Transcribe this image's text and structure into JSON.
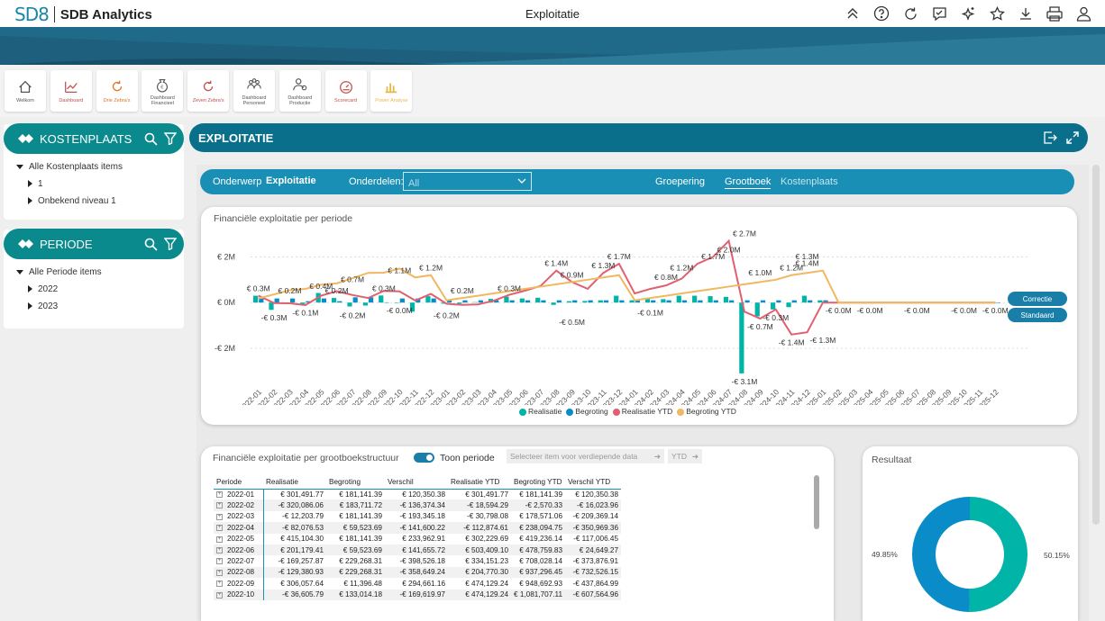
{
  "app": {
    "logo_mark": "SD8",
    "brand": "SDB Analytics",
    "title": "Exploitatie"
  },
  "topicons": [
    "collapse-icon",
    "help-icon",
    "refresh-icon",
    "comment-icon",
    "sparkle-icon",
    "favorite-icon",
    "download-icon",
    "print-icon",
    "user-icon"
  ],
  "nav": [
    {
      "label": "Welkom",
      "icon": "home-icon",
      "color": "#555555"
    },
    {
      "label": "Dashboard",
      "icon": "line-chart-icon",
      "color": "#c0504d"
    },
    {
      "label": "Drie Zebra's",
      "icon": "refresh-cycle-icon",
      "color": "#e07020"
    },
    {
      "label": "Dashboard Financieel",
      "icon": "money-bag-icon",
      "color": "#555555"
    },
    {
      "label": "Zeven Zebra's",
      "icon": "refresh-cycle-icon",
      "color": "#c0504d"
    },
    {
      "label": "Dashboard Personeel",
      "icon": "people-icon",
      "color": "#555555"
    },
    {
      "label": "Dashboard Productie",
      "icon": "worker-icon",
      "color": "#555555"
    },
    {
      "label": "Scorecard",
      "icon": "gauge-icon",
      "color": "#c0504d"
    },
    {
      "label": "Power Analyse",
      "icon": "bar-chart-icon",
      "color": "#e8b84a"
    }
  ],
  "kostenplaats": {
    "title": "KOSTENPLAATS",
    "items": [
      "Alle Kostenplaats items",
      "1",
      "Onbekend niveau 1"
    ]
  },
  "periode": {
    "title": "PERIODE",
    "items": [
      "Alle Periode items",
      "2022",
      "2023"
    ]
  },
  "exploitatie": {
    "title": "EXPLOITATIE"
  },
  "selbar": {
    "onderwerp_label": "Onderwerp",
    "onderwerp_value": "Exploitatie",
    "onderdelen_label": "Onderdelen:",
    "onderdelen_value": "All",
    "groepering": "Groepering",
    "grootboek": "Grootboek",
    "kostenplaats": "Kostenplaats"
  },
  "chart_title": "Financiële exploitatie per periode",
  "chart_buttons": {
    "correctie": "Correctie",
    "standaard": "Standaard"
  },
  "chart_data": {
    "type": "bar",
    "y_ticks": [
      "€ 2M",
      "€ 0M",
      "-€ 2M"
    ],
    "ylim": [
      -3.5,
      3.2
    ],
    "categories": [
      "2022-01",
      "2022-02",
      "2022-03",
      "2022-04",
      "2022-05",
      "2022-06",
      "2022-07",
      "2022-08",
      "2022-09",
      "2022-10",
      "2022-11",
      "2022-12",
      "2023-01",
      "2023-02",
      "2023-03",
      "2023-04",
      "2023-05",
      "2023-06",
      "2023-07",
      "2023-08",
      "2023-09",
      "2023-10",
      "2023-11",
      "2023-12",
      "2024-01",
      "2024-02",
      "2024-03",
      "2024-04",
      "2024-05",
      "2024-06",
      "2024-07",
      "2024-08",
      "2024-09",
      "2024-10",
      "2024-11",
      "2024-12",
      "2025-01",
      "2025-02",
      "2025-03",
      "2025-04",
      "2025-05",
      "2025-06",
      "2025-07",
      "2025-08",
      "2025-09",
      "2025-10",
      "2025-11",
      "2025-12"
    ],
    "series": [
      {
        "name": "Realisatie",
        "color": "#00b4a8",
        "values": [
          0.3,
          -0.32,
          -0.01,
          -0.08,
          0.42,
          0.2,
          -0.17,
          -0.13,
          0.31,
          -0.02,
          -0.4,
          0.28,
          -0.05,
          -0.05,
          0.02,
          0.16,
          0.26,
          0.18,
          0.21,
          -0.1,
          0.06,
          0.07,
          0.1,
          0.3,
          0.1,
          0.2,
          0.15,
          0.3,
          0.3,
          0.28,
          0.25,
          -3.1,
          -0.6,
          -0.3,
          -0.2,
          0.3,
          0.1,
          0,
          0,
          0,
          0,
          0,
          0,
          0,
          0,
          0,
          0,
          0
        ]
      },
      {
        "name": "Begroting",
        "color": "#0a8cc8",
        "values": [
          0.18,
          0.18,
          0.18,
          0.06,
          0.18,
          0.06,
          0.23,
          0.23,
          0.01,
          0.18,
          0.18,
          0.18,
          0.1,
          0.1,
          0.1,
          0.1,
          0.1,
          0.1,
          0.1,
          0.1,
          0.1,
          0.1,
          0.1,
          0.1,
          0.1,
          0.1,
          0.1,
          0.1,
          0.1,
          0.1,
          0.1,
          0.1,
          0.1,
          0.1,
          0.1,
          0.1,
          0.1,
          0,
          0,
          0,
          0,
          0,
          0,
          0,
          0,
          0,
          0,
          0
        ]
      },
      {
        "name": "Realisatie YTD",
        "color": "#e06070",
        "values": [
          0.3,
          -0.02,
          -0.03,
          -0.11,
          0.3,
          0.5,
          0.33,
          0.2,
          0.51,
          0.49,
          0.09,
          0.38,
          -0.05,
          -0.1,
          -0.08,
          0.08,
          0.34,
          0.52,
          0.73,
          1.4,
          0.9,
          0.6,
          1.3,
          1.7,
          0.4,
          0.6,
          0.75,
          1.05,
          1.7,
          2.0,
          2.7,
          -0.4,
          -0.7,
          -0.3,
          -1.4,
          -1.3,
          0,
          0,
          0,
          0,
          0,
          0,
          0,
          0,
          0,
          0,
          0,
          0
        ]
      },
      {
        "name": "Begroting YTD",
        "color": "#f0b860",
        "values": [
          0.18,
          0.36,
          0.54,
          0.6,
          0.78,
          0.84,
          1.07,
          1.3,
          1.31,
          1.49,
          1.1,
          1.2,
          0.1,
          0.2,
          0.3,
          0.4,
          0.5,
          0.6,
          0.7,
          0.8,
          0.9,
          1.0,
          1.1,
          1.2,
          0.1,
          0.2,
          0.3,
          0.4,
          0.5,
          0.6,
          0.7,
          0.8,
          0.9,
          1.0,
          1.2,
          1.3,
          1.4,
          0,
          0,
          0,
          0,
          0,
          0,
          0,
          0,
          0,
          0,
          0
        ]
      }
    ],
    "data_labels": [
      {
        "x": "2022-01",
        "text": "€ 0.3M"
      },
      {
        "x": "2022-02",
        "text": "-€ 0.3M"
      },
      {
        "x": "2022-03",
        "text": "€ 0.2M"
      },
      {
        "x": "2022-04",
        "text": "-€ 0.1M"
      },
      {
        "x": "2022-05",
        "text": "€ 0.4M"
      },
      {
        "x": "2022-06",
        "text": "€ 0.2M"
      },
      {
        "x": "2022-07",
        "text": "€ 0.7M"
      },
      {
        "x": "2022-07",
        "text": "-€ 0.2M"
      },
      {
        "x": "2022-09",
        "text": "€ 0.3M"
      },
      {
        "x": "2022-10",
        "text": "-€ 0.0M"
      },
      {
        "x": "2022-10",
        "text": "€ 1.1M"
      },
      {
        "x": "2022-12",
        "text": "€ 1.2M"
      },
      {
        "x": "2023-01",
        "text": "-€ 0.2M"
      },
      {
        "x": "2023-02",
        "text": "€ 0.2M"
      },
      {
        "x": "2023-05",
        "text": "€ 0.3M"
      },
      {
        "x": "2023-08",
        "text": "€ 1.4M"
      },
      {
        "x": "2023-09",
        "text": "€ 0.9M"
      },
      {
        "x": "2023-09",
        "text": "-€ 0.5M"
      },
      {
        "x": "2023-11",
        "text": "€ 1.3M"
      },
      {
        "x": "2023-12",
        "text": "€ 1.7M"
      },
      {
        "x": "2024-02",
        "text": "-€ 0.1M"
      },
      {
        "x": "2024-03",
        "text": "€ 0.8M"
      },
      {
        "x": "2024-04",
        "text": "€ 1.2M"
      },
      {
        "x": "2024-06",
        "text": "€ 1.7M"
      },
      {
        "x": "2024-07",
        "text": "€ 2.0M"
      },
      {
        "x": "2024-08",
        "text": "€ 2.7M"
      },
      {
        "x": "2024-08",
        "text": "-€ 3.1M"
      },
      {
        "x": "2024-09",
        "text": "€ 1.0M"
      },
      {
        "x": "2024-09",
        "text": "-€ 0.7M"
      },
      {
        "x": "2024-10",
        "text": "-€ 0.3M"
      },
      {
        "x": "2024-11",
        "text": "€ 1.2M"
      },
      {
        "x": "2024-11",
        "text": "-€ 1.4M"
      },
      {
        "x": "2024-12",
        "text": "€ 1.4M"
      },
      {
        "x": "2024-12",
        "text": "€ 1.3M"
      },
      {
        "x": "2025-01",
        "text": "-€ 1.3M"
      },
      {
        "x": "2025-02",
        "text": "-€ 0.0M"
      },
      {
        "x": "2025-04",
        "text": "-€ 0.0M"
      },
      {
        "x": "2025-07",
        "text": "-€ 0.0M"
      },
      {
        "x": "2025-10",
        "text": "-€ 0.0M"
      },
      {
        "x": "2025-12",
        "text": "-€ 0.0M"
      }
    ]
  },
  "table_card": {
    "title": "Financiële exploitatie per grootboekstructuur",
    "toggle_label": "Toon periode",
    "drill_placeholder": "Selecteer item voor verdiepende data",
    "ytd_label": "YTD"
  },
  "table": {
    "columns": [
      "Periode",
      "Realisatie",
      "Begroting",
      "Verschil",
      "Realisatie YTD",
      "Begroting YTD",
      "Verschil YTD"
    ],
    "rows": [
      [
        "2022-01",
        "€ 301,491.77",
        "€ 181,141.39",
        "€ 120,350.38",
        "€ 301,491.77",
        "€ 181,141.39",
        "€ 120,350.38"
      ],
      [
        "2022-02",
        "-€ 320,086.06",
        "€ 183,711.72",
        "-€ 136,374.34",
        "-€ 18,594.29",
        "-€ 2,570.33",
        "-€ 16,023.96"
      ],
      [
        "2022-03",
        "-€ 12,203.79",
        "€ 181,141.39",
        "-€ 193,345.18",
        "-€ 30,798.08",
        "€ 178,571.06",
        "-€ 209,369.14"
      ],
      [
        "2022-04",
        "-€ 82,076.53",
        "€ 59,523.69",
        "-€ 141,600.22",
        "-€ 112,874.61",
        "€ 238,094.75",
        "-€ 350,969.36"
      ],
      [
        "2022-05",
        "€ 415,104.30",
        "€ 181,141.39",
        "€ 233,962.91",
        "€ 302,229.69",
        "€ 419,236.14",
        "-€ 117,006.45"
      ],
      [
        "2022-06",
        "€ 201,179.41",
        "€ 59,523.69",
        "€ 141,655.72",
        "€ 503,409.10",
        "€ 478,759.83",
        "€ 24,649.27"
      ],
      [
        "2022-07",
        "-€ 169,257.87",
        "€ 229,268.31",
        "-€ 398,526.18",
        "€ 334,151.23",
        "€ 708,028.14",
        "-€ 373,876.91"
      ],
      [
        "2022-08",
        "-€ 129,380.93",
        "€ 229,268.31",
        "-€ 358,649.24",
        "€ 204,770.30",
        "€ 937,296.45",
        "-€ 732,526.15"
      ],
      [
        "2022-09",
        "€ 306,057.64",
        "€ 11,396.48",
        "€ 294,661.16",
        "€ 474,129.24",
        "€ 948,692.93",
        "-€ 437,864.99"
      ],
      [
        "2022-10",
        "-€ 36,605.79",
        "€ 133,014.18",
        "-€ 169,619.97",
        "€ 474,129.24",
        "€ 1,081,707.11",
        "-€ 607,564.96"
      ]
    ]
  },
  "resultaat": {
    "title": "Resultaat",
    "left_pct": "49.85%",
    "right_pct": "50.15%",
    "left_value": 49.85,
    "right_value": 50.15,
    "left_color": "#0a8cc8",
    "right_color": "#00b4a8"
  }
}
